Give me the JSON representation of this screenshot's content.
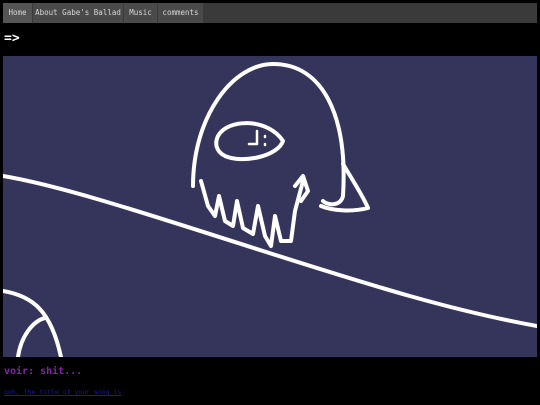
{
  "nav": {
    "items": [
      {
        "label": "Home"
      },
      {
        "label": "About Gabe's Ballad"
      },
      {
        "label": "Music"
      },
      {
        "label": "comments"
      }
    ]
  },
  "page": {
    "arrow": "=>",
    "dialog": "voir: shit...",
    "next_link": "ooh, the title of your song is"
  },
  "colors": {
    "panel_bg": "#35355b",
    "dialog_text": "#8a1fb5",
    "link": "#1a1a9a"
  }
}
